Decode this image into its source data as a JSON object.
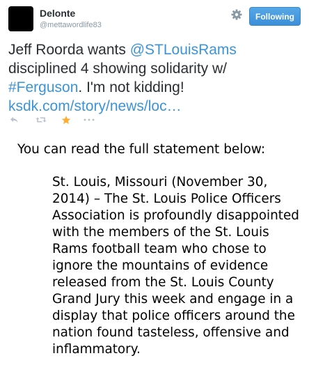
{
  "tweet": {
    "author": {
      "display_name": "Delonte",
      "screen_name": "@mettawordlife83"
    },
    "follow_button_label": "Following",
    "text": {
      "part1": "Jeff Roorda wants ",
      "mention": "@STLouisRams",
      "part2": " disciplined 4 showing solidarity w/ ",
      "hashtag": "#Ferguson",
      "part3": ". I'm not kidding! ",
      "link": "ksdk.com/story/news/loc…"
    },
    "actions": {
      "reply_icon": "reply-icon",
      "retweet_icon": "retweet-icon",
      "favorite_icon": "star-icon",
      "more_icon": "more-icon",
      "favorite_color": "#ffac33"
    }
  },
  "statement": {
    "intro": "You can read the full statement below:",
    "quote": "St. Louis, Missouri (November 30, 2014) – The St. Louis Police Officers Association is profoundly disappointed with the members of the St. Louis Rams football team who chose to ignore the mountains of evidence released from the St. Louis County Grand Jury this week and engage in a display that police officers around the nation found tasteless, offensive and inflammatory."
  },
  "colors": {
    "link": "#3b94d9",
    "button": "#4aa0e0",
    "muted": "#8899a6"
  }
}
